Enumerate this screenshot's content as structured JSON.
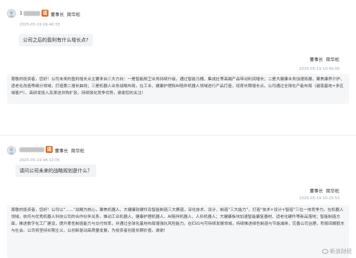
{
  "threads": [
    {
      "user": {
        "prefix": "1"
      },
      "ticker": "诺",
      "role": "董事长",
      "person": "周华松",
      "question_time": "2025-05-19 09:46:33",
      "question": "公司之后的盈利有什么增长点?",
      "answer_role": "董事长",
      "answer_person": "周华松",
      "answer_time": "2025-05-19 10:46:00",
      "answer": "尊敬的投资者，您好！公司未来的盈利增长点主要来自三大方向：一是智能厨卫业务持续升级，通过智能马桶、集成灶等高端产品带动利润增长；二是大健康业务加速拓展，聚焦康养介护、适老化改造等细分领域，打造第二增长曲线；三是机器人业务战略布局，在工业、健康护理和AI陪伴机器人领域进行产品打造，培育长期增长点。公司通过全球化产能布局（越南基地+多区域客户）、高研发投入及渐进并购扩张，持续强化竞争优势，谢谢您的关注！"
    },
    {
      "user": {
        "prefix": ""
      },
      "ticker": "诺",
      "role": "董事长",
      "person": "周华松",
      "question_time": "2025-05-19 08:12:05",
      "question": "请问公司未来的战略规划是什么？",
      "answer_role": "董事长",
      "answer_person": "周华松",
      "answer_time": "2025-05-19 10:25:53",
      "answer": "尊敬的投资者，您好！公司以“……”战略为核心，聚焦机器人、大健康软硬件及智能制造三大赛道，深化技术、设计、制造“三大能力”，打造“技术+设计+智造”三位一体竞争力。在机器人领域，依托与优秀机器人科技公司的合作伙伴关系，推动工业机器人、健康护理机器人、AI陪伴机器人、人形机器人；大健康板块加速智能康复器材、适老化硬件等新品落地；智能制造方面，推进数字化工厂建设，提升柔性制造能力与交付效率，并通过全球化基地布局增强抗风险能力。在ESG与可持续发展领域，持续推进绿色制造与节能减排，完善公司治理，积极回报股东与社会。公司将坚持长期主义，以创新驱动高质量发展，为投资者创造长期价值，谢谢！"
    }
  ],
  "watermark": "新浪财经"
}
